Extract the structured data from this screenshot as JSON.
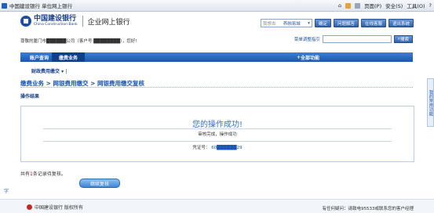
{
  "browser": {
    "tab_title": "中国建设银行  单位网上银行",
    "tools": {
      "home": "⌂",
      "page": "页面(P)",
      "safety": "安全(S)",
      "tools": "工具(O)",
      "help": "?"
    }
  },
  "header": {
    "logo_cn": "中国建设银行",
    "logo_en": "China Construction Bank",
    "portal_title": "企业网上银行",
    "search_placeholder": "我想去",
    "search_value": "养融易城",
    "confirm_label": "确定",
    "btn_help": "问题解答",
    "btn_online": "在线客服",
    "btn_exit": "退出系统"
  },
  "user_row": {
    "greeting": "尊敬的厦门市██████公司（客户号:████████），您好!",
    "guide": "菜单调整指引",
    "search_label": "搜索"
  },
  "nav": {
    "items": [
      {
        "label": "账户查询"
      },
      {
        "label": "缴费业务"
      }
    ],
    "all_functions": "全部功能"
  },
  "subnav": {
    "item": "财政费用缴交",
    "sep": "|"
  },
  "breadcrumb": {
    "text": "缴费业务 > 网银费用缴交 > 网银费用缴交复核"
  },
  "section": {
    "label": "操作结果"
  },
  "result": {
    "title": "您的操作成功!",
    "message": "审核完成，操作成功",
    "voucher_label": "凭证号：",
    "voucher_value": "60██████29"
  },
  "footer_note": {
    "prefix": "共有",
    "count": "1",
    "suffix": "条记录待复核。"
  },
  "continue_button": "继续复核",
  "left_mark": "字",
  "bottom": {
    "copyright": "中国建设银行  版权所有",
    "contact": "有任何疑问：请致电95533或联系您的客户经理"
  },
  "side_tab": "我的常用功能",
  "colors": {
    "brand_blue": "#1a57b5",
    "nav_blue": "#1b57ad",
    "success_blue": "#2f6fc7"
  }
}
